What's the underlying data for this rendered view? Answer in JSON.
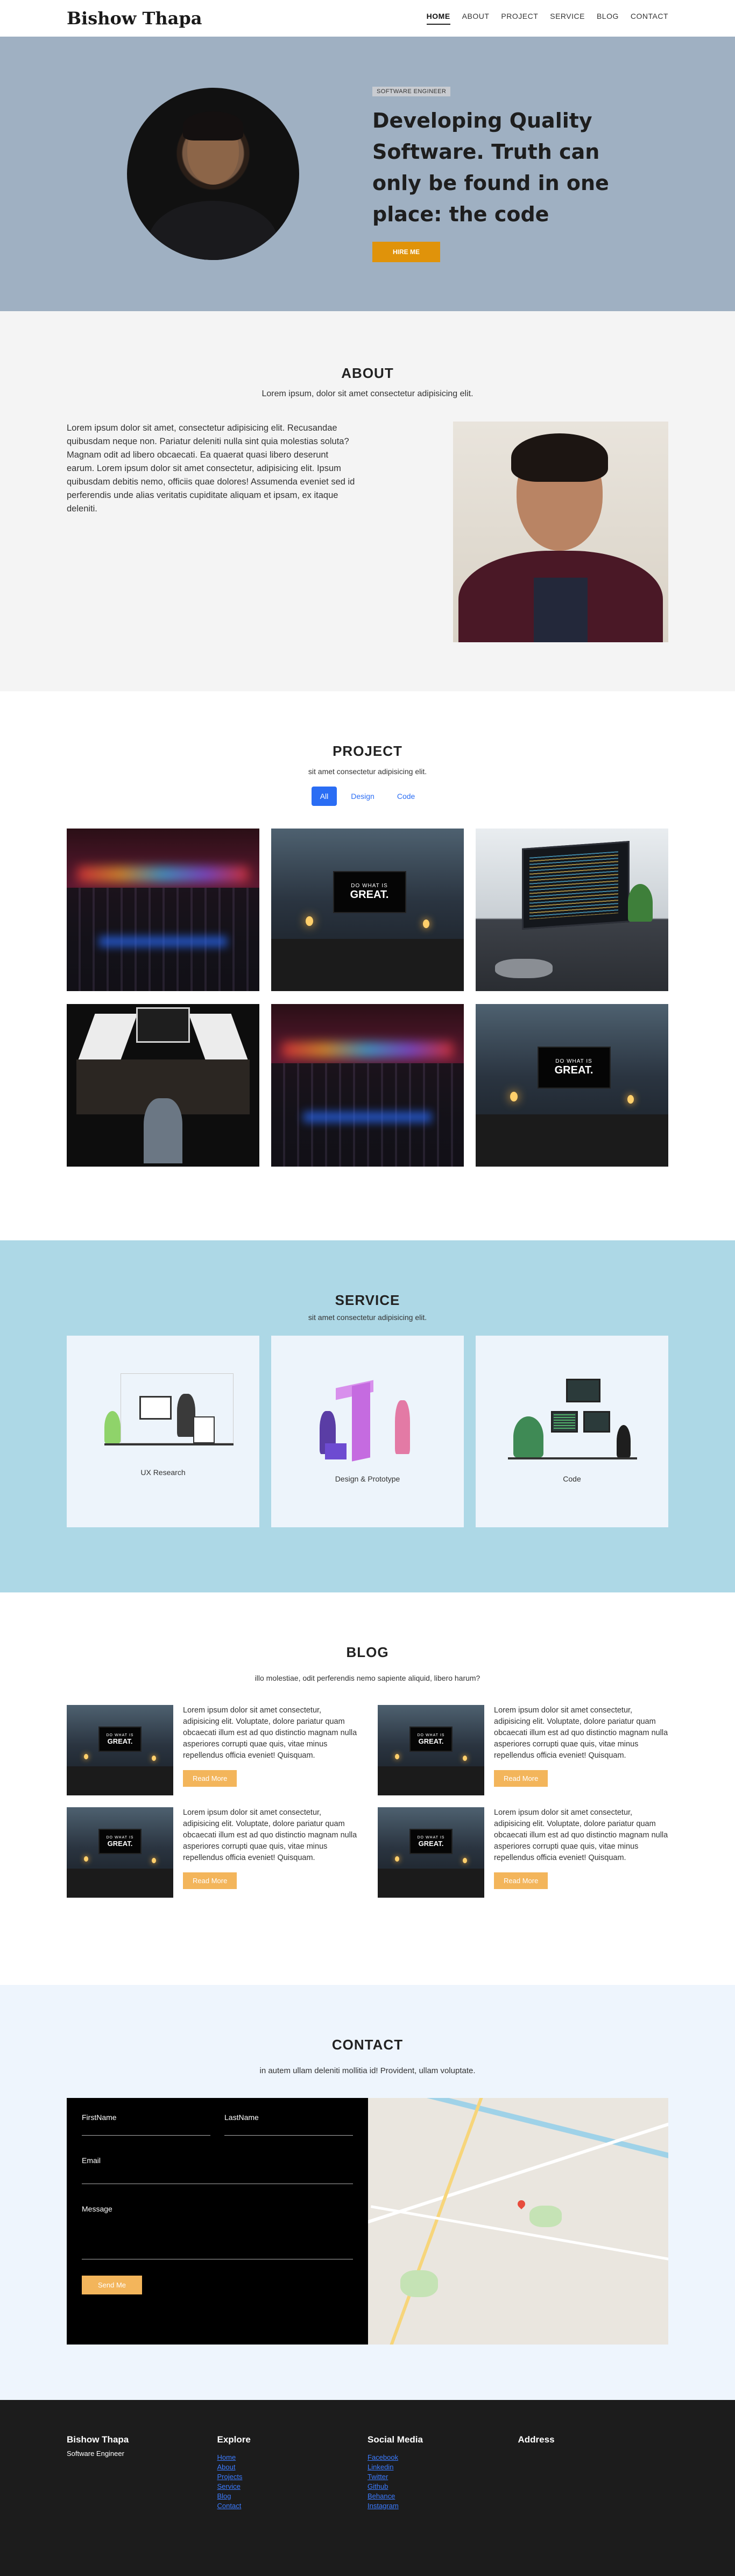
{
  "nav": {
    "brand": "Bishow Thapa",
    "links": [
      "HOME",
      "ABOUT",
      "PROJECT",
      "SERVICE",
      "BLOG",
      "CONTACT"
    ],
    "active": "HOME"
  },
  "hero": {
    "badge": "SOFTWARE ENGINEER",
    "headline": "Developing Quality Software. Truth can only be found in one place: the code",
    "cta": "HIRE ME"
  },
  "about": {
    "title": "ABOUT",
    "subtitle": "Lorem ipsum, dolor sit amet consectetur adipisicing elit.",
    "body": "Lorem ipsum dolor sit amet, consectetur adipisicing elit. Recusandae quibusdam neque non. Pariatur deleniti nulla sint quia molestias soluta? Magnam odit ad libero obcaecati. Ea quaerat quasi libero deserunt earum. Lorem ipsum dolor sit amet consectetur, adipisicing elit. Ipsum quibusdam debitis nemo, officiis quae dolores! Assumenda eveniet sed id perferendis unde alias veritatis cupiditate aliquam et ipsam, ex itaque deleniti."
  },
  "project": {
    "title": "PROJECT",
    "subtitle": "sit amet consectetur adipisicing elit.",
    "filters": [
      "All",
      "Design",
      "Code"
    ],
    "active_filter": "All",
    "screen_text_small": "DO WHAT IS",
    "screen_text_big": "GREAT."
  },
  "service": {
    "title": "SERVICE",
    "subtitle": "sit amet consectetur adipisicing elit.",
    "cards": [
      "UX Research",
      "Design & Prototype",
      "Code"
    ]
  },
  "blog": {
    "title": "BLOG",
    "subtitle": "illo molestiae, odit perferendis nemo sapiente aliquid, libero harum?",
    "excerpt": "Lorem ipsum dolor sit amet consectetur, adipisicing elit. Voluptate, dolore pariatur quam obcaecati illum est ad quo distinctio magnam nulla asperiores corrupti quae quis, vitae minus repellendus officia eveniet! Quisquam.",
    "read_more": "Read More",
    "screen_text_small": "DO WHAT IS",
    "screen_text_big": "GREAT."
  },
  "contact": {
    "title": "CONTACT",
    "subtitle": "in autem ullam deleniti mollitia id! Provident, ullam voluptate.",
    "first_name": "FirstName",
    "last_name": "LastName",
    "email": "Email",
    "message": "Message",
    "send": "Send Me"
  },
  "footer": {
    "brand": "Bishow Thapa",
    "tagline": "Software Engineer",
    "explore_title": "Explore",
    "explore_links": [
      "Home",
      "About",
      "Projects",
      "Service",
      "Blog",
      "Contact"
    ],
    "social_title": "Social Media",
    "social_links": [
      "Facebook",
      "Linkedin",
      "Twitter",
      "Github",
      "Behance",
      "Instagram"
    ],
    "address_title": "Address"
  }
}
